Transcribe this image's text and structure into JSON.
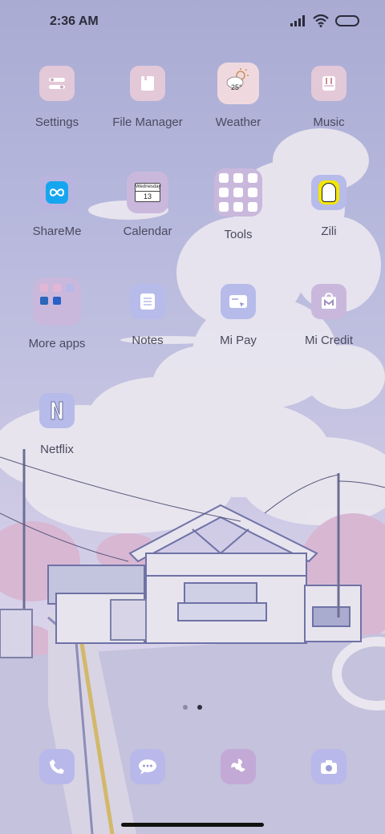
{
  "status_bar": {
    "time": "2:36 AM"
  },
  "apps": {
    "settings": "Settings",
    "file_manager": "File Manager",
    "weather": "Weather",
    "weather_temp": "25°",
    "music": "Music",
    "shareme": "ShareMe",
    "calendar": "Calendar",
    "calendar_day": "Wednesday",
    "calendar_date": "13",
    "tools": "Tools",
    "zili": "Zili",
    "more_apps": "More apps",
    "notes": "Notes",
    "mi_pay": "Mi Pay",
    "mi_credit": "Mi Credit",
    "netflix": "Netflix"
  },
  "pagination": {
    "current_page": 2,
    "total_pages": 2
  },
  "dock": [
    "phone-icon",
    "messages-icon",
    "browser-icon",
    "camera-icon"
  ],
  "colors": {
    "icon_pink": "#e3c8d8",
    "icon_lilac": "#c9b8dc",
    "dock_icon": "#b9b8ea",
    "label_text": "#4a4a5e"
  }
}
